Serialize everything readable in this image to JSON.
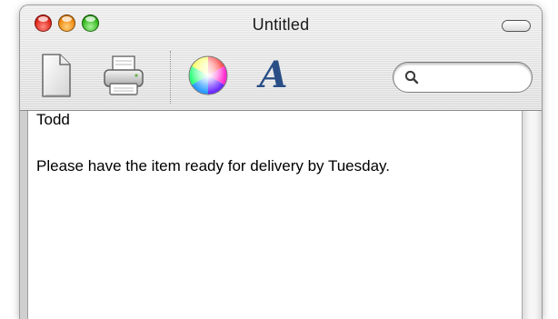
{
  "window": {
    "title": "Untitled"
  },
  "titlebar": {
    "buttons": [
      "close-icon",
      "minimize-icon",
      "zoom-icon"
    ],
    "toolbar_toggle": "toolbar-toggle-icon"
  },
  "toolbar": {
    "items": [
      {
        "icon": "new-document-icon"
      },
      {
        "icon": "print-icon"
      },
      {
        "icon": "color-wheel-icon"
      },
      {
        "icon": "font-icon",
        "glyph": "A"
      }
    ],
    "search": {
      "icon": "search-icon",
      "value": "",
      "placeholder": ""
    }
  },
  "document": {
    "lines": [
      "Todd",
      "Please have the item ready for delivery by Tuesday."
    ]
  },
  "colors": {
    "close": "#e0281c",
    "minimize": "#f08a10",
    "zoom": "#36b81f",
    "font_glyph": "#2a4f86"
  }
}
